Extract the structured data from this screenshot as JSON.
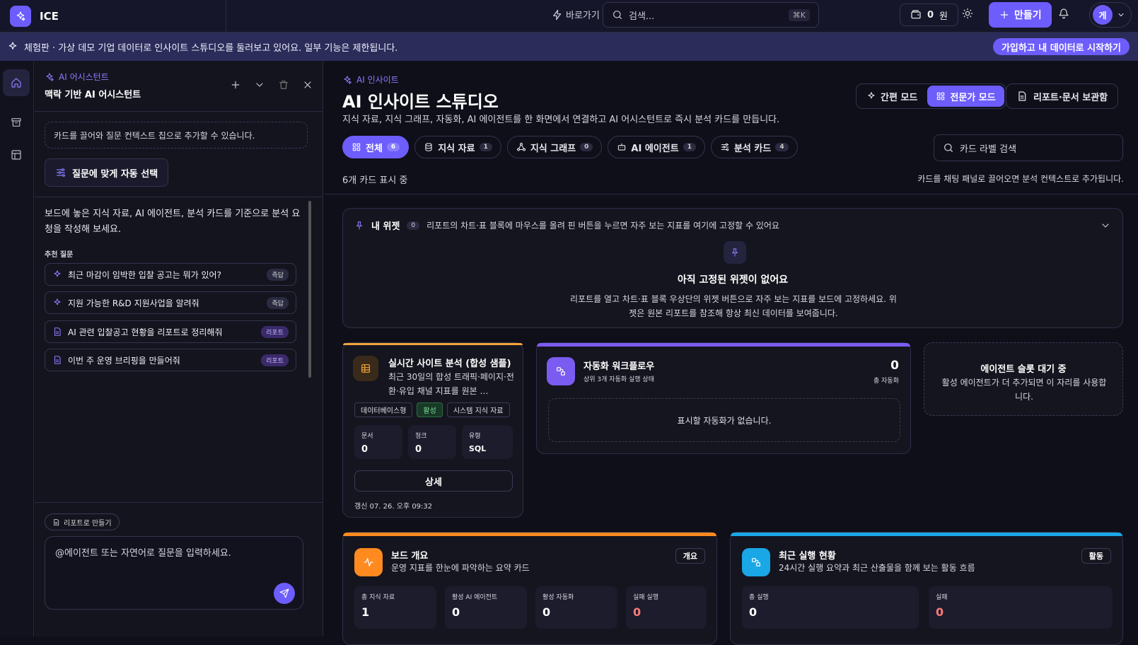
{
  "topbar": {
    "brand": "ICE",
    "shortcut_label": "바로가기",
    "search_placeholder": "검색...",
    "search_kbd": "⌘K",
    "credit_value": "0",
    "credit_unit": "원",
    "make_button": "만들기",
    "avatar_initial": "게"
  },
  "banner": {
    "text": "체험판 · 가상 데모 기업 데이터로 인사이트 스튜디오를 둘러보고 있어요. 일부 기능은 제한됩니다.",
    "cta": "가입하고 내 데이터로 시작하기"
  },
  "assistant": {
    "eyebrow": "AI 어시스턴트",
    "title": "맥락 기반 AI 어시스턴트",
    "drop_hint": "카드를 끌어와 질문 컨텍스트 칩으로 추가할 수 있습니다.",
    "auto_select": "질문에 맞게 자동 선택",
    "intro": "보드에 놓은 지식 자료, AI 에이전트, 분석 카드를 기준으로 분석 요청을 작성해 보세요.",
    "suggest_label": "추천 질문",
    "suggestions": [
      {
        "text": "최근 마감이 임박한 입찰 공고는 뭐가 있어?",
        "tag": "즉답"
      },
      {
        "text": "지원 가능한 R&D 지원사업을 알려줘",
        "tag": "즉답"
      },
      {
        "text": "AI 관련 입찰공고 현황을 리포트로 정리해줘",
        "tag": "리포트"
      },
      {
        "text": "이번 주 운영 브리핑을 만들어줘",
        "tag": "리포트"
      }
    ],
    "report_chip": "리포트로 만들기",
    "composer_placeholder": "@에이전트 또는 자연어로 질문을 입력하세요."
  },
  "main": {
    "eyebrow": "AI 인사이트",
    "title": "AI 인사이트 스튜디오",
    "subtitle": "지식 자료, 지식 그래프, 자동화, AI 에이전트를 한 화면에서 연결하고 AI 어시스턴트로 즉시 분석 카드를 만듭니다.",
    "mode_simple": "간편 모드",
    "mode_expert": "전문가 모드",
    "archive": "리포트·문서 보관함",
    "filters": [
      {
        "label": "전체",
        "count": "6"
      },
      {
        "label": "지식 자료",
        "count": "1"
      },
      {
        "label": "지식 그래프",
        "count": "0"
      },
      {
        "label": "AI 에이전트",
        "count": "1"
      },
      {
        "label": "분석 카드",
        "count": "4"
      }
    ],
    "label_search_placeholder": "카드 라벨 검색",
    "count_text": "6개 카드 표시 중",
    "drag_hint": "카드를 채팅 패널로 끌어오면 분석 컨텍스트로 추가됩니다."
  },
  "widgets": {
    "title": "내 위젯",
    "count": "0",
    "hint": "리포트의 차트·표 블록에 마우스를 올려 핀 버튼을 누르면 자주 보는 지표를 여기에 고정할 수 있어요",
    "empty_title": "아직 고정된 위젯이 없어요",
    "empty_desc": "리포트를 열고 차트·표 블록 우상단의 위젯 버튼으로 자주 보는 지표를 보드에 고정하세요. 위젯은 원본 리포트를 참조해 항상 최신 데이터를 보여줍니다."
  },
  "card_site": {
    "title": "실시간 사이트 분석 (합성 샘플)",
    "desc": "최근 30일의 합성 트래픽·페이지·전환·유입 채널 지표를 원본 …",
    "tags": [
      "데이터베이스형",
      "활성",
      "시스템 지식 자료"
    ],
    "stats": [
      {
        "label": "문서",
        "value": "0"
      },
      {
        "label": "청크",
        "value": "0"
      },
      {
        "label": "유형",
        "value": "SQL"
      }
    ],
    "detail": "상세",
    "updated": "갱신 07. 26. 오후 09:32"
  },
  "card_auto": {
    "title": "자동화 워크플로우",
    "desc": "상위 3개 자동화 실행 상태",
    "total_value": "0",
    "total_label": "총 자동화",
    "empty": "표시할 자동화가 없습니다."
  },
  "card_agent_slot": {
    "title": "에이전트 슬롯 대기 중",
    "desc": "활성 에이전트가 더 추가되면 이 자리를 사용합니다."
  },
  "card_overview": {
    "title": "보드 개요",
    "desc": "운영 지표를 한눈에 파악하는 요약 카드",
    "badge": "개요",
    "stats": [
      {
        "label": "총 지식 자료",
        "value": "1"
      },
      {
        "label": "활성 AI 에이전트",
        "value": "0"
      },
      {
        "label": "활성 자동화",
        "value": "0"
      },
      {
        "label": "실패 실행",
        "value": "0"
      }
    ]
  },
  "card_recent": {
    "title": "최근 실행 현황",
    "desc": "24시간 실행 요약과 최근 산출물을 함께 보는 활동 흐름",
    "badge": "활동",
    "stats": [
      {
        "label": "총 실행",
        "value": "0"
      },
      {
        "label": "실패",
        "value": "0"
      }
    ]
  },
  "colors": {
    "accent": "#6d5dfc",
    "orange": "#ff8a1f",
    "cyan": "#1aa7e6",
    "amber": "#f2a33a",
    "green": "#7fd89b",
    "danger": "#ff7a7a"
  }
}
